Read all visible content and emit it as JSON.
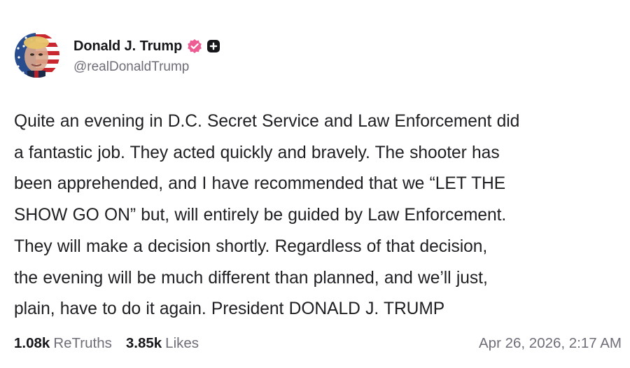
{
  "author": {
    "display_name": "Donald J. Trump",
    "handle": "@realDonaldTrump",
    "avatar_icon": "avatar-flag-portrait",
    "verified_icon": "verified-check-icon",
    "plus_icon": "plus-badge-icon"
  },
  "post": {
    "lines": [
      "Quite an evening in D.C. Secret Service and Law Enforcement did",
      "a fantastic job. They acted quickly and bravely. The shooter has",
      "been apprehended, and I have recommended that we “LET THE",
      "SHOW GO ON” but, will entirely be guided by Law Enforcement.",
      "They will make a decision shortly. Regardless of that decision,",
      "the evening will be much different than planned, and we’ll just,",
      "plain, have to do it again. President DONALD J. TRUMP"
    ]
  },
  "stats": {
    "retruths_count": "1.08k",
    "retruths_label": "ReTruths",
    "likes_count": "3.85k",
    "likes_label": "Likes"
  },
  "timestamp": "Apr 26, 2026, 2:17 AM",
  "colors": {
    "verified_badge": "#ed5c92",
    "text_primary": "#17161b",
    "text_secondary": "#6f6e78"
  }
}
